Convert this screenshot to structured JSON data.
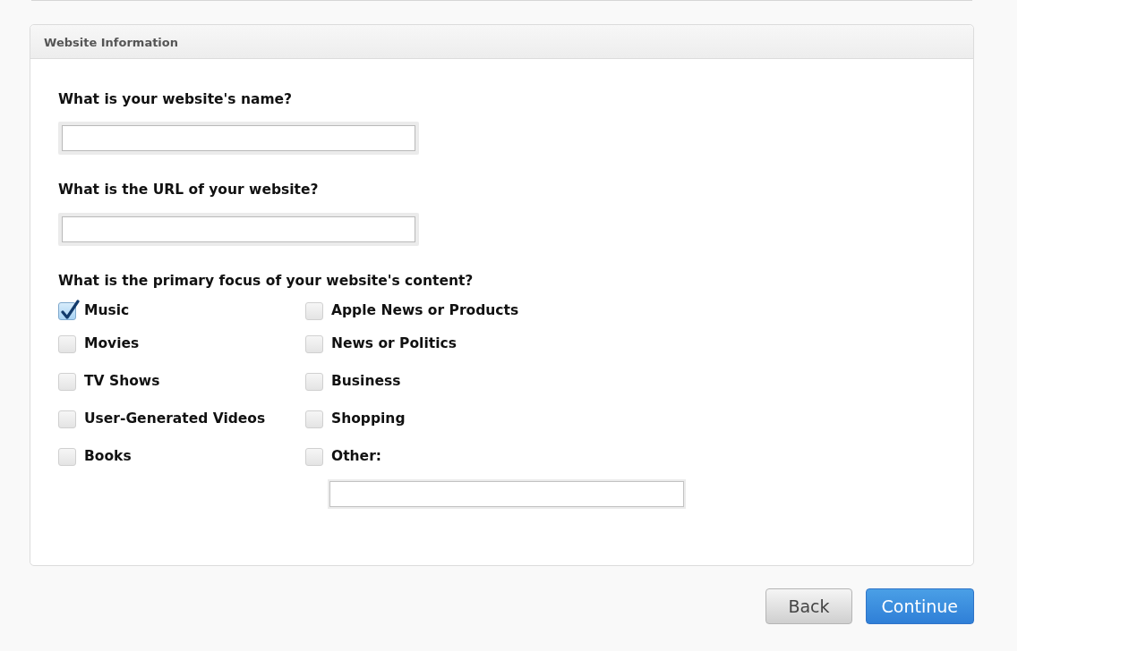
{
  "panel": {
    "title": "Website Information",
    "questions": [
      {
        "label": "What is your website's name?"
      },
      {
        "label": "What is the URL of your website?"
      }
    ],
    "focus": {
      "label": "What is the primary focus of your website's content?",
      "columns": [
        [
          {
            "label": "Music",
            "checked": true,
            "kind": "checkbox"
          },
          {
            "label": "Movies",
            "checked": false,
            "kind": "checkbox"
          },
          {
            "label": "TV Shows",
            "checked": false,
            "kind": "checkbox"
          },
          {
            "label": "User-Generated Videos",
            "checked": false,
            "kind": "checkbox"
          },
          {
            "label": "Books",
            "checked": false,
            "kind": "checkbox"
          }
        ],
        [
          {
            "label": "Apple News or Products",
            "checked": false,
            "kind": "checkbox"
          },
          {
            "label": "News or Politics",
            "checked": false,
            "kind": "checkbox"
          },
          {
            "label": "Business",
            "checked": false,
            "kind": "checkbox"
          },
          {
            "label": "Shopping",
            "checked": false,
            "kind": "checkbox"
          },
          {
            "label": "Other:",
            "checked": false,
            "kind": "other"
          }
        ]
      ]
    }
  },
  "buttons": [
    {
      "label": "Back",
      "kind": "secondary"
    },
    {
      "label": "Continue",
      "kind": "primary"
    }
  ]
}
